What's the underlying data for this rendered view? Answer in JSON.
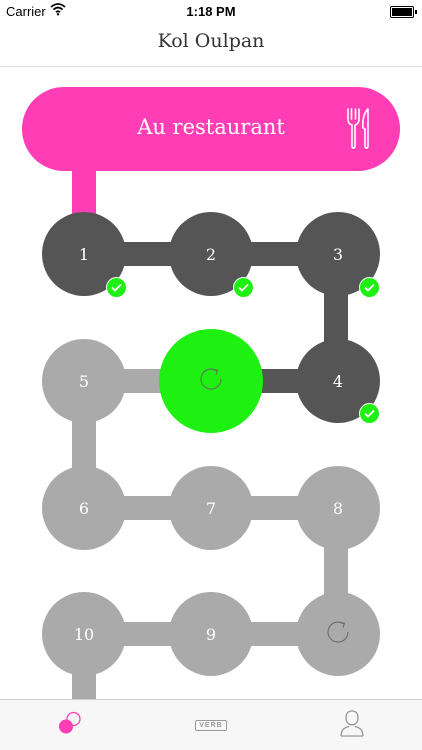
{
  "status_bar": {
    "carrier": "Carrier",
    "time": "1:18 PM"
  },
  "nav": {
    "title": "Kol Oulpan"
  },
  "lesson": {
    "title": "Au restaurant",
    "icon": "utensils-icon",
    "color": "#ff3eb5"
  },
  "colors": {
    "completed": "#555555",
    "locked": "#aaaaaa",
    "current": "#1ef012",
    "check": "#1ef012"
  },
  "levels": [
    {
      "label": "1",
      "status": "completed"
    },
    {
      "label": "2",
      "status": "completed"
    },
    {
      "label": "3",
      "status": "completed"
    },
    {
      "label": "4",
      "status": "completed"
    },
    {
      "label": "",
      "status": "current",
      "icon": "refresh-icon"
    },
    {
      "label": "5",
      "status": "locked"
    },
    {
      "label": "6",
      "status": "locked"
    },
    {
      "label": "7",
      "status": "locked"
    },
    {
      "label": "8",
      "status": "locked"
    },
    {
      "label": "",
      "status": "locked",
      "icon": "refresh-icon"
    },
    {
      "label": "9",
      "status": "locked"
    },
    {
      "label": "10",
      "status": "locked"
    }
  ],
  "tabs": [
    {
      "name": "lessons",
      "icon": "lessons-icon",
      "active": true
    },
    {
      "name": "verb",
      "label": "VERB",
      "icon": "verb-icon",
      "active": false
    },
    {
      "name": "profile",
      "icon": "profile-icon",
      "active": false
    }
  ]
}
